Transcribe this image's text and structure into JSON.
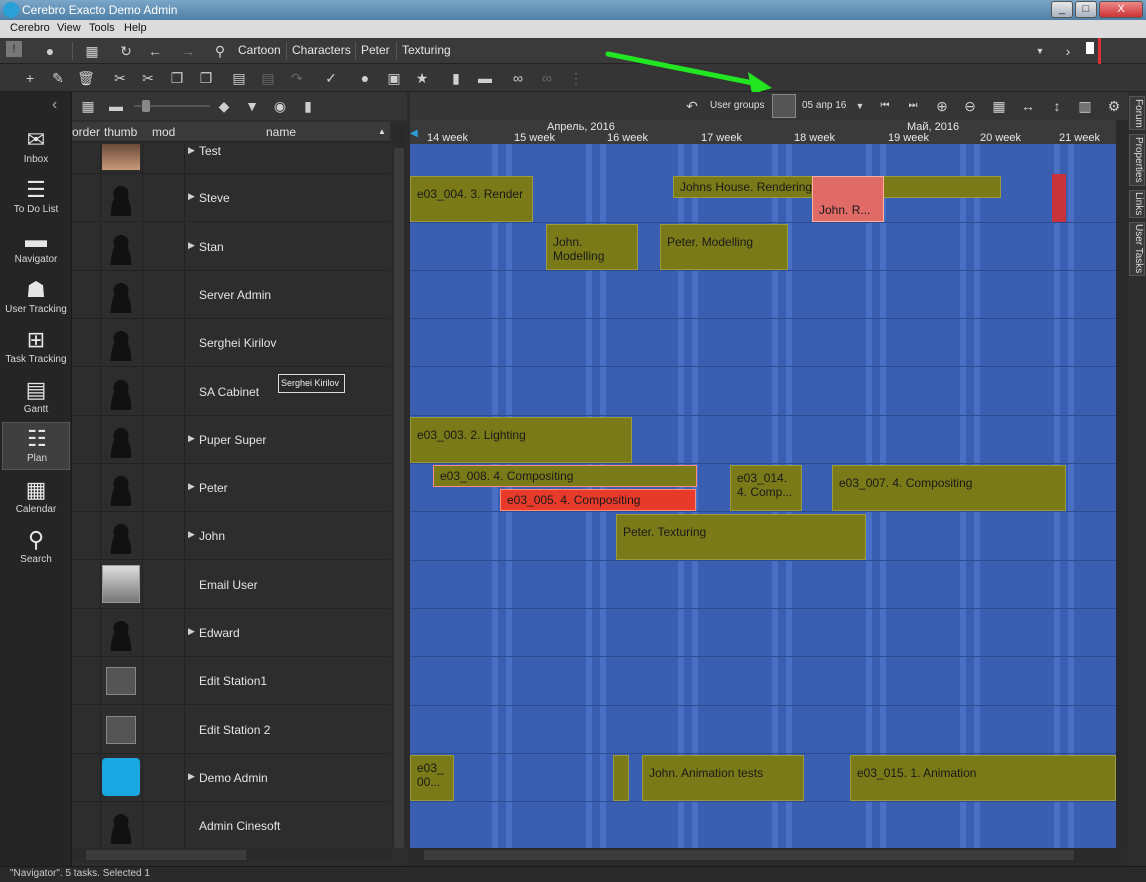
{
  "window": {
    "title": "Cerebro Exacto   Demo Admin",
    "controls": {
      "minimize": "_",
      "maximize": "□",
      "close": "X"
    }
  },
  "menu": [
    "Cerebro",
    "View",
    "Tools",
    "Help"
  ],
  "breadcrumb": [
    "Cartoon",
    "Characters",
    "Peter",
    "Texturing"
  ],
  "sidebar": [
    {
      "label": "Inbox",
      "icon": "envelope-icon"
    },
    {
      "label": "To Do List",
      "icon": "checklist-icon"
    },
    {
      "label": "Navigator",
      "icon": "folder-icon"
    },
    {
      "label": "User Tracking",
      "icon": "users-icon"
    },
    {
      "label": "Task Tracking",
      "icon": "task-tracking-icon"
    },
    {
      "label": "Gantt",
      "icon": "gantt-icon"
    },
    {
      "label": "Plan",
      "icon": "plan-icon"
    },
    {
      "label": "Calendar",
      "icon": "calendar-icon"
    },
    {
      "label": "Search",
      "icon": "search-icon"
    }
  ],
  "columns": {
    "order": "order",
    "thumb": "thumb",
    "mod": "mod",
    "name": "name"
  },
  "rows": [
    {
      "name": "Test",
      "expand": "▶",
      "thumb": "photo"
    },
    {
      "name": "Steve",
      "expand": "▶",
      "thumb": "person"
    },
    {
      "name": "Stan",
      "expand": "▶",
      "thumb": "person"
    },
    {
      "name": "Server Admin",
      "expand": "",
      "thumb": "person"
    },
    {
      "name": "Serghei Kirilov",
      "expand": "",
      "thumb": "person"
    },
    {
      "name": "SA Cabinet",
      "expand": "",
      "thumb": "person"
    },
    {
      "name": "Puper Super",
      "expand": "▶",
      "thumb": "person"
    },
    {
      "name": "Peter",
      "expand": "▶",
      "thumb": "person"
    },
    {
      "name": "John",
      "expand": "▶",
      "thumb": "person"
    },
    {
      "name": "Email User",
      "expand": "",
      "thumb": "silhouette"
    },
    {
      "name": "Edward",
      "expand": "▶",
      "thumb": "person"
    },
    {
      "name": "Edit Station1",
      "expand": "",
      "thumb": "box"
    },
    {
      "name": "Edit Station 2",
      "expand": "",
      "thumb": "box"
    },
    {
      "name": "Demo Admin",
      "expand": "▶",
      "thumb": "logo"
    },
    {
      "name": "Admin Cinesoft",
      "expand": "",
      "thumb": "person"
    }
  ],
  "tooltip": "Serghei Kirilov",
  "gantt_toolbar": {
    "user_groups": "User groups",
    "date": "05 апр 16"
  },
  "months": [
    "Апрель, 2016",
    "Май, 2016"
  ],
  "weeks": [
    "14 week",
    "15 week",
    "16 week",
    "17 week",
    "18 week",
    "19 week",
    "20 week",
    "21 week"
  ],
  "tasks": [
    {
      "label": "e03_004. 3. Render",
      "style": "olive"
    },
    {
      "label": "Johns House. Rendering Tests",
      "style": "olive"
    },
    {
      "label": "John. R...",
      "style": "pink"
    },
    {
      "label": "John. Modelling",
      "style": "olive"
    },
    {
      "label": "Peter. Modelling",
      "style": "olive"
    },
    {
      "label": "e03_003. 2. Lighting",
      "style": "olive"
    },
    {
      "label": "e03_008. 4. Compositing",
      "style": "red"
    },
    {
      "label": "e03_005. 4. Compositing",
      "style": "red"
    },
    {
      "label": "e03_014. 4. Comp...",
      "style": "olive"
    },
    {
      "label": "e03_007. 4. Compositing",
      "style": "olive"
    },
    {
      "label": "Peter. Texturing",
      "style": "olive"
    },
    {
      "label": "e03_ 00...",
      "style": "olive"
    },
    {
      "label": "John. Animation tests",
      "style": "olive"
    },
    {
      "label": "e03_015. 1. Animation",
      "style": "olive"
    }
  ],
  "right_tabs": [
    "Forum",
    "Properties",
    "Links",
    "User Tasks"
  ],
  "status": "\"Navigator\". 5 tasks. Selected 1"
}
